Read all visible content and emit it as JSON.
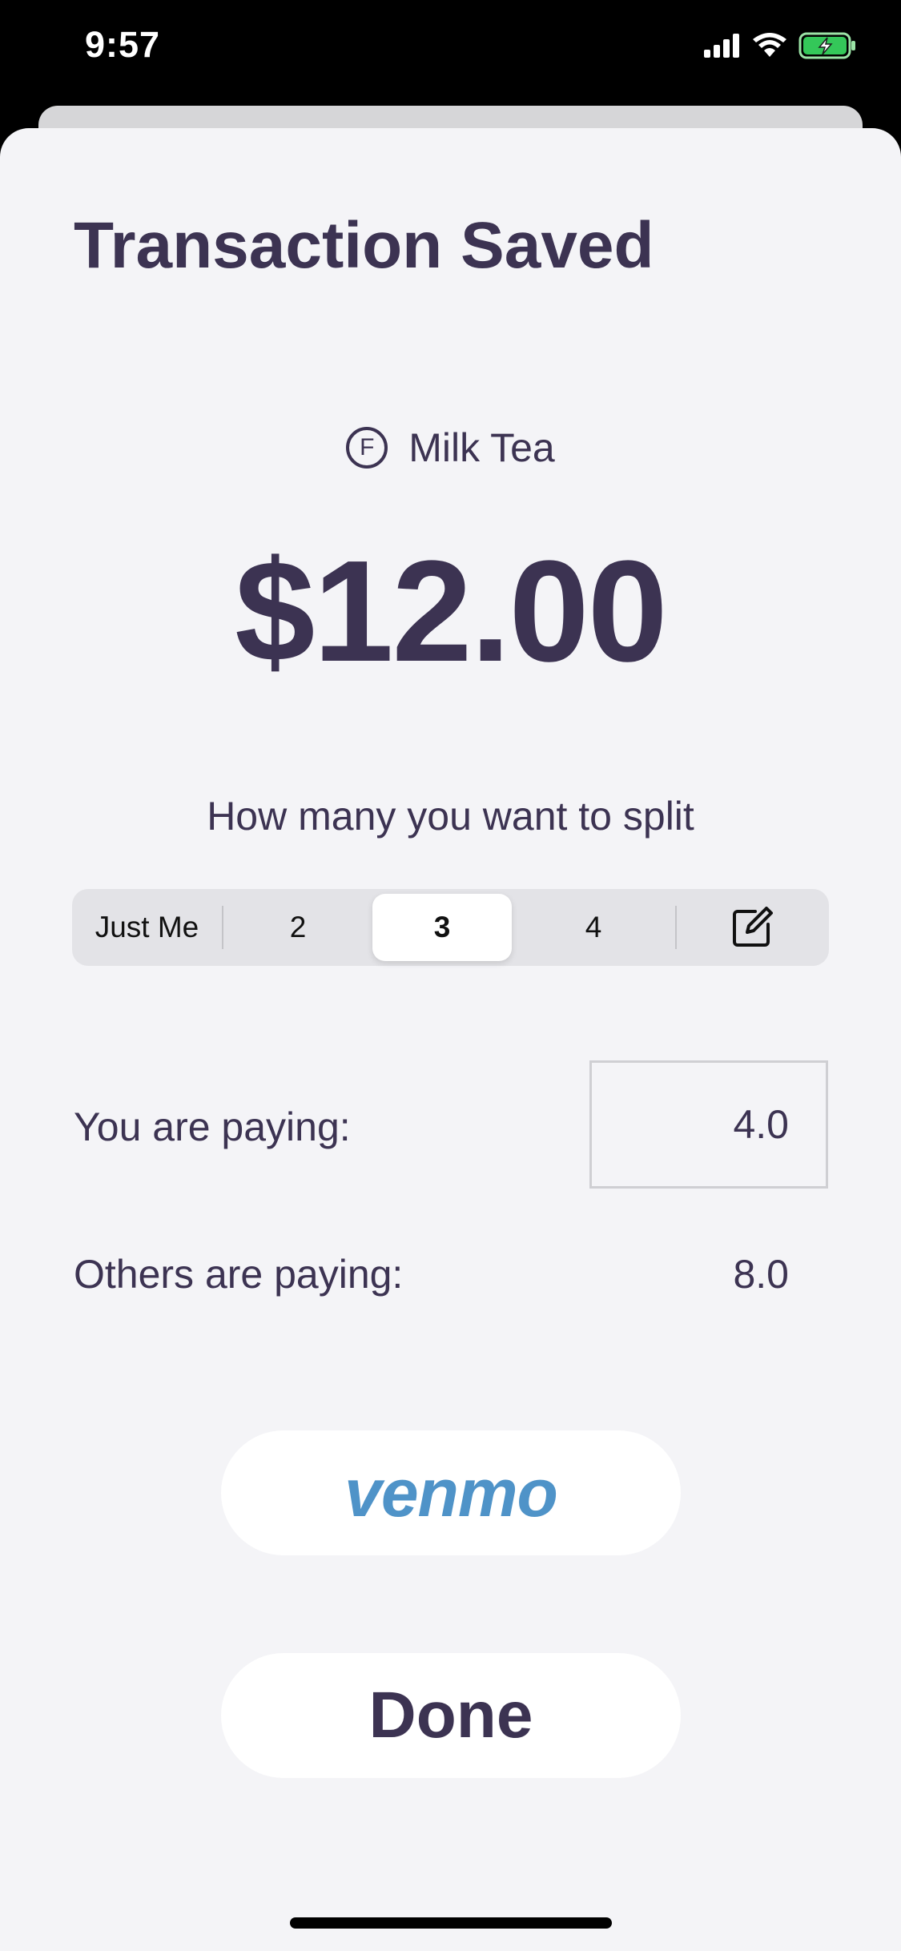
{
  "status_bar": {
    "time": "9:57",
    "icons": [
      "cellular-signal-icon",
      "wifi-icon",
      "battery-charging-icon"
    ],
    "battery_color": "#34c759"
  },
  "sheet": {
    "title": "Transaction Saved",
    "merchant": {
      "icon_letter": "F",
      "icon": "circled-f-icon",
      "name": "Milk Tea"
    },
    "amount": "$12.00",
    "split_prompt": "How many you want to split",
    "split_options": [
      {
        "label": "Just Me",
        "selected": false
      },
      {
        "label": "2",
        "selected": false
      },
      {
        "label": "3",
        "selected": true
      },
      {
        "label": "4",
        "selected": false
      },
      {
        "label": "",
        "icon": "compose-icon",
        "selected": false
      }
    ],
    "you_paying_label": "You are paying:",
    "you_paying_value": "4.0",
    "others_paying_label": "Others are paying:",
    "others_paying_value": "8.0",
    "venmo_label": "venmo",
    "done_label": "Done"
  },
  "colors": {
    "text_primary": "#3c3352",
    "sheet_background": "#f4f4f7",
    "venmo_blue": "#4f93c8"
  }
}
